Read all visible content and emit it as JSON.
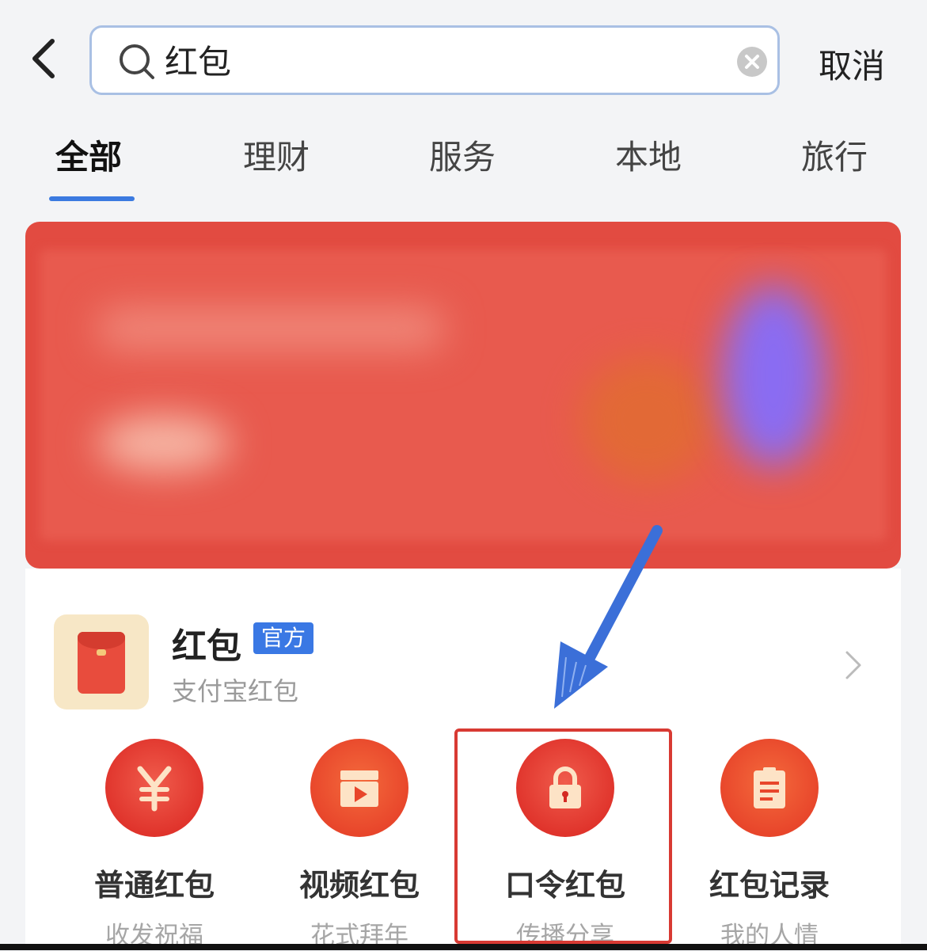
{
  "header": {
    "search_value": "红包",
    "cancel_label": "取消"
  },
  "tabs": [
    {
      "label": "全部",
      "active": true
    },
    {
      "label": "理财",
      "active": false
    },
    {
      "label": "服务",
      "active": false
    },
    {
      "label": "本地",
      "active": false
    },
    {
      "label": "旅行",
      "active": false
    }
  ],
  "app_card": {
    "name": "红包",
    "badge": "官方",
    "subtitle": "支付宝红包",
    "icon": "red-envelope-icon",
    "features": [
      {
        "label": "普通红包",
        "sub": "收发祝福",
        "icon": "yuan-icon"
      },
      {
        "label": "视频红包",
        "sub": "花式拜年",
        "icon": "video-clapper-icon"
      },
      {
        "label": "口令红包",
        "sub": "传播分享",
        "icon": "lock-icon"
      },
      {
        "label": "红包记录",
        "sub": "我的人情",
        "icon": "clipboard-icon"
      }
    ]
  },
  "colors": {
    "accent_blue": "#3b7ae0",
    "banner_red": "#e24b41",
    "highlight_red": "#d83a33"
  }
}
